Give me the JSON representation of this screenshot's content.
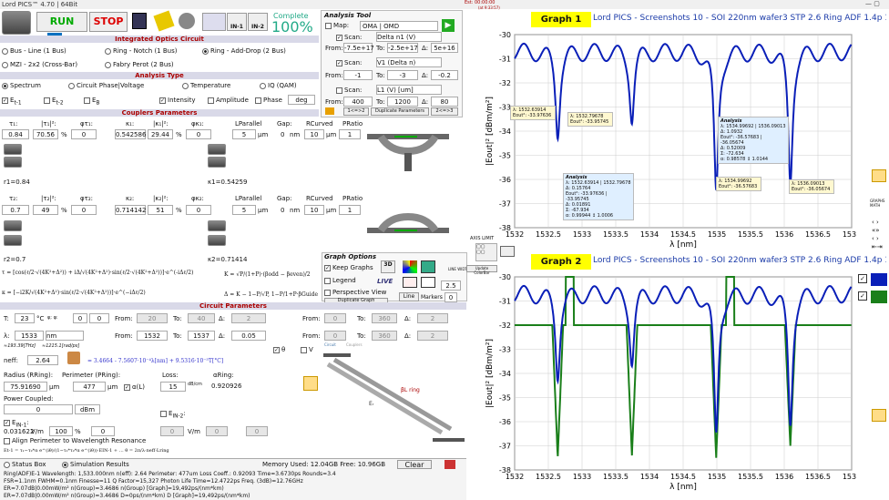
{
  "window": {
    "title": "Lord PICS™ 4.70 | 64Bit",
    "est": "Est: 00:00:00",
    "left": "Left: -00:00:04",
    "est_small": "(at 9:33:57)"
  },
  "toolbar": {
    "run": "RUN",
    "stop": "STOP",
    "complete_label": "Complete",
    "complete_pct": "100%",
    "in1": "IN-1",
    "in2": "IN-2"
  },
  "circuit": {
    "header": "Integrated Optics Circuit",
    "opt1": "Bus - Line (1 Bus)",
    "opt2": "Ring - Notch (1 Bus)",
    "opt3": "Ring - Add-Drop (2 Bus)",
    "opt4": "MZI - 2x2 (Cross-Bar)",
    "opt5": "Fabry Perot (2 Bus)"
  },
  "analysis_type": {
    "header": "Analysis Type",
    "opt1": "Spectrum",
    "opt2": "Circuit Phase|Voltage",
    "opt3": "Temperature",
    "opt4": "IQ (QAM)",
    "e1": "E",
    "e2": "E",
    "e3": "E",
    "sub1": "t-1",
    "sub2": "t-2",
    "sub3": "B",
    "intensity": "Intensity",
    "amplitude": "Amplitude",
    "phase": "Phase",
    "deg": "deg"
  },
  "analysis_tool": {
    "title": "Analysis Tool",
    "map": "Map:",
    "map_val": "OMA | OMD",
    "scan1": "Scan:",
    "scan1_val": "Delta n1 (V)",
    "from": "From:",
    "to": "To:",
    "d": "Δ:",
    "s1_from": "-7.5e+17",
    "s1_to": "-2.5e+17",
    "s1_d": "5e+16",
    "scan2_val": "V1 (Delta n)",
    "s2_from": "-1",
    "s2_to": "-3",
    "s2_d": "-0.2",
    "scan3_val": "L1 (V) [um]",
    "s3_from": "400",
    "s3_to": "1200",
    "s3_d": "80",
    "b1": "1<=>2",
    "b2": "Duplicate Parameters",
    "b3": "2<=>3"
  },
  "couplers": {
    "header": "Couplers Parameters",
    "t1": "0.84",
    "t1sq": "70.56",
    "phi_t1": "0",
    "k1": "0.542586",
    "k1sq": "29.44",
    "phi_k1": "0",
    "l_par1": "5",
    "gap1": "0",
    "r1": "10",
    "p1": "1",
    "t2": "0.7",
    "t2sq": "49",
    "phi_t2": "0",
    "k2": "0.714142",
    "k2sq": "51",
    "phi_k2": "0",
    "l_par2": "5",
    "gap2": "0",
    "r2": "10",
    "p2": "1",
    "r1lbl": "r1=0.84",
    "kap1lbl": "κ1=0.54259",
    "r2lbl": "r2=0.7",
    "kap2lbl": "κ2=0.71414",
    "pct": "%",
    "um": "µm",
    "nm": "nm",
    "lpar": "LParallel",
    "gaplbl": "Gap:",
    "rcurv": "RCurved",
    "pratio": "PRatio"
  },
  "graph_options": {
    "title": "Graph Options",
    "keep": "Keep Graphs",
    "legend": "Legend",
    "persp": "Perspective View",
    "dup": "Duplicate Graph",
    "live": "LIVE",
    "line": "Line",
    "markers": "Markers",
    "axis": "AXIS LIMIT",
    "update": "Update ColorBar",
    "linewidth": "2.5",
    "linewidth_lbl": "LINE WIDTH"
  },
  "circuit_params": {
    "header": "Circuit Parameters",
    "T": "23",
    "tunit": "°C",
    "zero": "0",
    "lambda": "1533",
    "lunit": "nm",
    "from1": "20",
    "to1": "40",
    "d1": "2",
    "from2": "1532",
    "to2": "1537",
    "d2": "0.05",
    "from3": "0",
    "to3": "360",
    "d3": "2",
    "from4": "0",
    "to4": "360",
    "d4": "2",
    "freq": "≈193.39[THz]",
    "rad": "≈1215.1[rad/ps]",
    "neff": "2.64",
    "neff_eq": "= 3.4664 - 7.5607·10⁻⁴λ[nm] + 9.5316·10⁻⁵T[°C]",
    "radius": "75.91690",
    "radius_lbl": "Radius (RRing):",
    "perim": "477",
    "perim_lbl": "Perimeter (PRing):",
    "loss": "15",
    "loss_lbl": "Loss:",
    "dbcm": "dB/cm",
    "aring": "0.920926",
    "aring_lbl": "αRing:",
    "powc": "0",
    "powc_lbl": "Power Coupled:",
    "dbm": "dBm",
    "ein1": "0.031622",
    "ein1_u": "V/m",
    "ein1_pct": "100",
    "ein2": "0",
    "ein2_u": "V/m",
    "ein2_pct": "0",
    "align": "Align Perimeter to Wavelength Resonance",
    "circuit_tab": "Circuit",
    "couplers_tab": "Couplers",
    "theta": "θ",
    "V": "V",
    "ering": "Ering"
  },
  "status": {
    "tab1": "Status Box",
    "tab2": "Simulation Results",
    "mem": "Memory Used: 12.04GB  Free: 10.96GB",
    "clear": "Clear",
    "line1": "Ring(ADF)E-1   Wavelength: 1,533.000nm   n(eff): 2.64   Perimeter: 477um   Loss Coeff.: 0.92093   Time=3.6730ps   Rounds=3.4",
    "line2": "FSR=1.1nm    FWHM=0.1nm    Finesse=11    Q Factor=15,327    Photon Life Time=12.4722ps    Freq. (3dB)=12.76GHz",
    "line3": "ER=7.07dB|0.00mW/m²    n(Group)=3.4686    n(Group) [Graph]=19,492ps/(nm*km)",
    "line4": "ER=7.07dB|0.00mW/m²    n(Group)=3.4686    D=0ps/(nm*km)    D [Graph]=19,492ps/(nm*km)"
  },
  "graph1": {
    "tag": "Graph 1",
    "title": "Lord PICS - Screenshots 10 - SOI 220nm wafer3 STP 2.6 Ring ADF 1.4p 1 H(TM) Out",
    "ylabel": "|Eout|² [dBm/m²]",
    "xlabel": "λ [nm]",
    "yticks": [
      "-30",
      "-31",
      "-32",
      "-33",
      "-34",
      "-35",
      "-36",
      "-37",
      "-38"
    ],
    "xticks": [
      "1532",
      "1532.5",
      "1533",
      "1533.5",
      "1534",
      "1534.5",
      "1535",
      "1535.5",
      "1536",
      "1536.5",
      "1537"
    ]
  },
  "graph2": {
    "tag": "Graph 2",
    "title": "Lord PICS - Screenshots 10 - SOI 220nm wafer3 STP 2.6 Ring ADF 1.4p 1 H(TM) Out",
    "ylabel": "|Eout|² [dBm/m²]",
    "xlabel": "λ [nm]",
    "yticks": [
      "-30",
      "-31",
      "-32",
      "-33",
      "-34",
      "-35",
      "-36",
      "-37",
      "-38"
    ],
    "xticks": [
      "1532",
      "1532.5",
      "1533",
      "1533.5",
      "1534",
      "1534.5",
      "1535",
      "1535.5",
      "1536",
      "1536.5",
      "1537"
    ]
  },
  "annotations": {
    "a1": "λ: 1532.63914",
    "a1b": "Eout²: -33.97636",
    "a2": "λ: 1532.79678",
    "a2b": "Eout²: -33.95745",
    "an1t": "Analysis",
    "an1a": "λ: 1532.63914  |  1532.79678",
    "an1b": "Δ: 0.15764",
    "an1c": "Eout²: -33.97636  |  -33.95745",
    "an1d": "Δ: 0.01891",
    "an1e": "Σ: -67.934",
    "an1f": "α: 0.99944 ↕ 1.0006",
    "an2t": "Analysis",
    "an2a": "λ: 1534.99692  |  1536.09013",
    "an2b": "Δ: 1.0932",
    "an2c": "Eout²: -36.57683  |  -36.05674",
    "an2d": "Δ: 0.52009",
    "an2e": "Σ: -72.634",
    "an2f": "α: 0.98578 ↕ 1.0144",
    "a3": "λ: 1534.99692",
    "a3b": "Eout²: -36.57683",
    "a4": "λ: 1536.09013",
    "a4b": "Eout²: -36.05674"
  },
  "colors": {
    "blue": "#0a1fb8",
    "green": "#1a7f1a",
    "yellow": "#ffff00",
    "header_bg": "#d9d9e8"
  }
}
